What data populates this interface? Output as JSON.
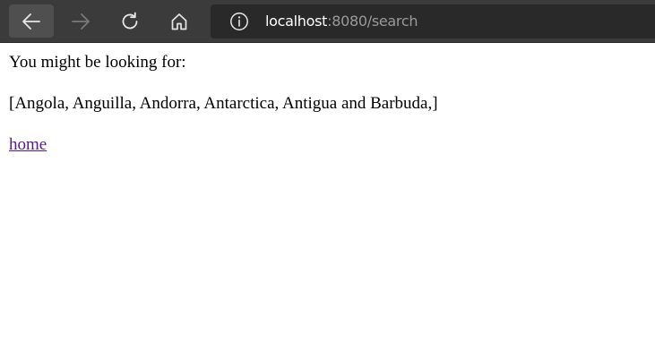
{
  "browser": {
    "url_host": "localhost",
    "url_rest": ":8080/search",
    "icons": {
      "back": "arrow-left-icon",
      "forward": "arrow-right-icon",
      "refresh": "refresh-icon",
      "home": "home-icon",
      "info": "info-icon"
    },
    "forward_disabled": true
  },
  "page": {
    "intro": "You might be looking for:",
    "results": "[Angola, Anguilla, Andorra, Antarctica, Antigua and Barbuda,]",
    "home_link": "home"
  },
  "colors": {
    "toolbar": "#3b3b3b",
    "address_bar": "#292929",
    "visited_link": "#551a8b"
  }
}
